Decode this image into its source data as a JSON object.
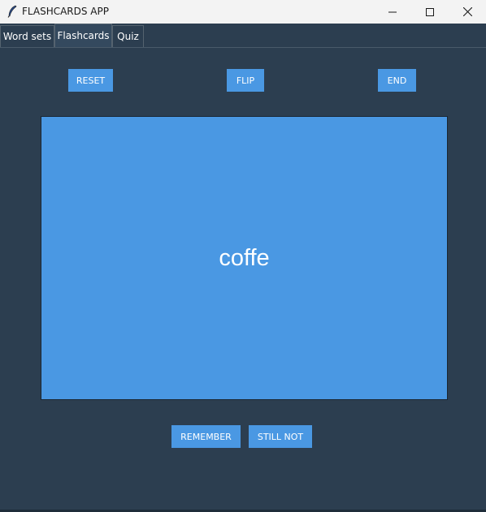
{
  "window": {
    "title": "FLASHCARDS APP",
    "controls": [
      "minimize-icon",
      "maximize-icon",
      "close-icon"
    ]
  },
  "tabs": [
    {
      "label": "Word sets",
      "active": false
    },
    {
      "label": "Flashcards",
      "active": true
    },
    {
      "label": "Quiz",
      "active": false
    }
  ],
  "toolbar": {
    "reset_label": "RESET",
    "flip_label": "FLIP",
    "end_label": "END"
  },
  "card": {
    "word": "coffe"
  },
  "answer_buttons": {
    "remember_label": "REMEMBER",
    "still_not_label": "STILL NOT"
  },
  "colors": {
    "background": "#2c3e50",
    "accent": "#4a98e3",
    "text": "#ffffff"
  }
}
